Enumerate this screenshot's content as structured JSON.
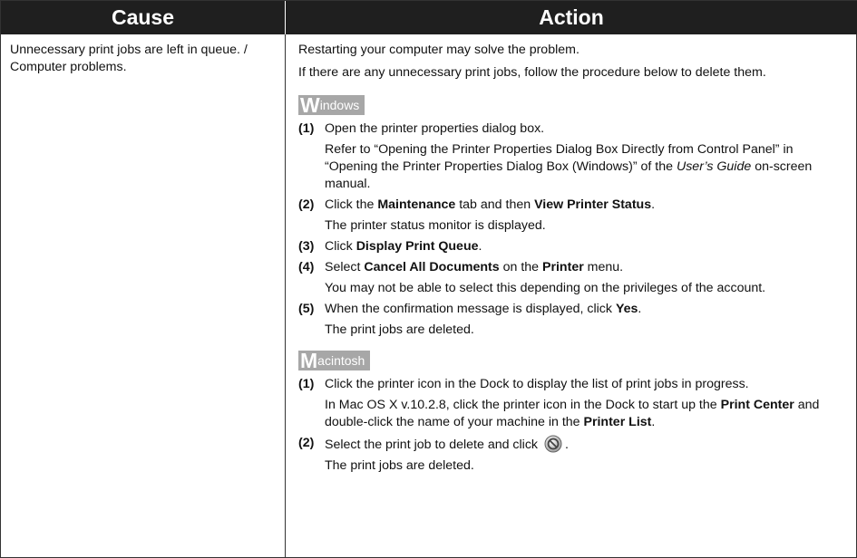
{
  "header": {
    "cause": "Cause",
    "action": "Action"
  },
  "cause": "Unnecessary print jobs are left in queue. / Computer problems.",
  "intro": [
    "Restarting your computer may solve the problem.",
    "If there are any unnecessary print jobs, follow the procedure below to delete them."
  ],
  "windows": {
    "badge_initial": "W",
    "badge_rest": "indows",
    "steps": [
      {
        "num": "(1)",
        "text": "Open the printer properties dialog box.",
        "note": {
          "a": "Refer to “Opening the Printer Properties Dialog Box Directly from Control Panel” in “Opening the Printer Properties Dialog Box (Windows)” of the ",
          "em": "User’s Guide",
          "b": " on-screen manual."
        }
      },
      {
        "num": "(2)",
        "t1": "Click the ",
        "b1": "Maintenance",
        "t2": " tab and then ",
        "b2": "View Printer Status",
        "t3": ".",
        "note": "The printer status monitor is displayed."
      },
      {
        "num": "(3)",
        "t1": "Click ",
        "b1": "Display Print Queue",
        "t2": "."
      },
      {
        "num": "(4)",
        "t1": "Select ",
        "b1": "Cancel All Documents",
        "t2": " on the ",
        "b2": "Printer",
        "t3": " menu.",
        "note": "You may not be able to select this depending on the privileges of the account."
      },
      {
        "num": "(5)",
        "t1": "When the confirmation message is displayed, click ",
        "b1": "Yes",
        "t2": ".",
        "note": "The print jobs are deleted."
      }
    ]
  },
  "mac": {
    "badge_initial": "M",
    "badge_rest": "acintosh",
    "steps": [
      {
        "num": "(1)",
        "text": "Click the printer icon in the Dock to display the list of print jobs in progress.",
        "note": {
          "a": "In Mac OS X v.10.2.8, click the printer icon in the Dock to start up the ",
          "b1": "Print Center",
          "c": " and double-click the name of your machine in the ",
          "b2": "Printer List",
          "d": "."
        }
      },
      {
        "num": "(2)",
        "t1": "Select the print job to delete and click",
        "t2": ".",
        "icon": "cancel-icon",
        "note": "The print jobs are deleted."
      }
    ]
  },
  "colors": {
    "header_bg": "#1f1f1f",
    "badge_bg": "#a7a7a7",
    "border": "#333333"
  }
}
